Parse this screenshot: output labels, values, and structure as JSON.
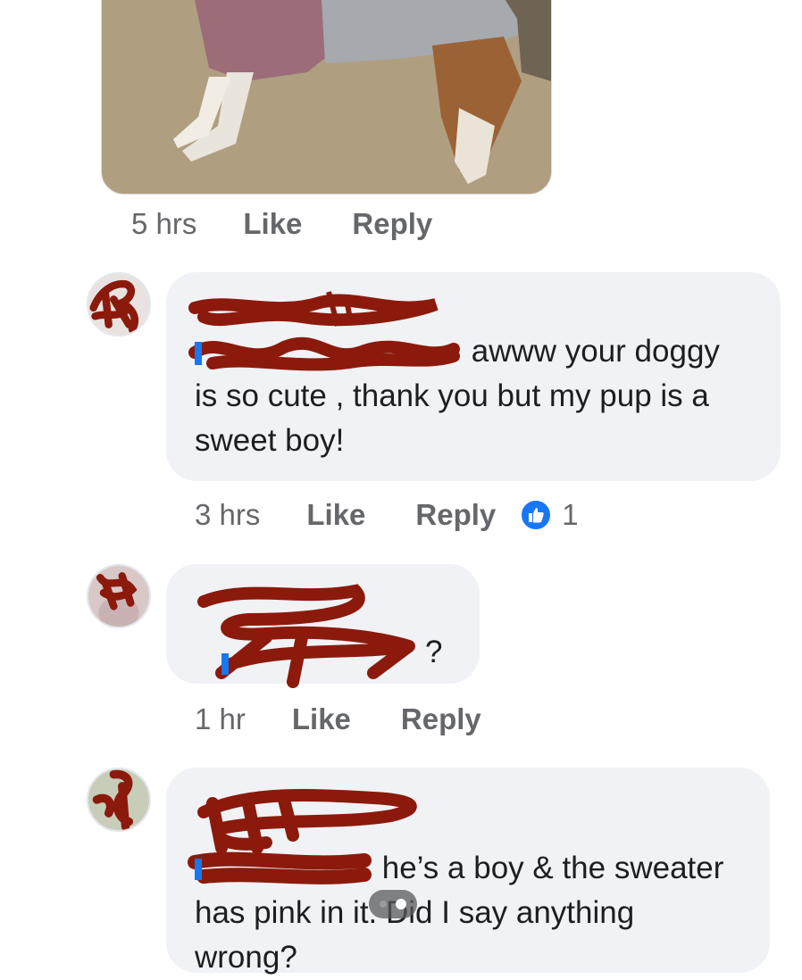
{
  "post_actions": {
    "time": "5 hrs",
    "like": "Like",
    "reply": "Reply"
  },
  "comments": [
    {
      "text_inline": "awww your doggy",
      "text_rest": "is so cute , thank you but my pup is a sweet boy!",
      "time": "3 hrs",
      "like": "Like",
      "reply": "Reply",
      "reaction_count": "1"
    },
    {
      "text_inline": "?",
      "time": "1 hr",
      "like": "Like",
      "reply": "Reply"
    },
    {
      "text_inline": "he’s a boy & the sweater",
      "text_rest": "has pink in it. Did I say anything wrong?"
    }
  ],
  "colors": {
    "accent": "#1877f2",
    "redaction": "#8b1a0c",
    "bubble": "#f0f2f5"
  },
  "icons": {
    "reaction": "thumbs-up-icon"
  }
}
